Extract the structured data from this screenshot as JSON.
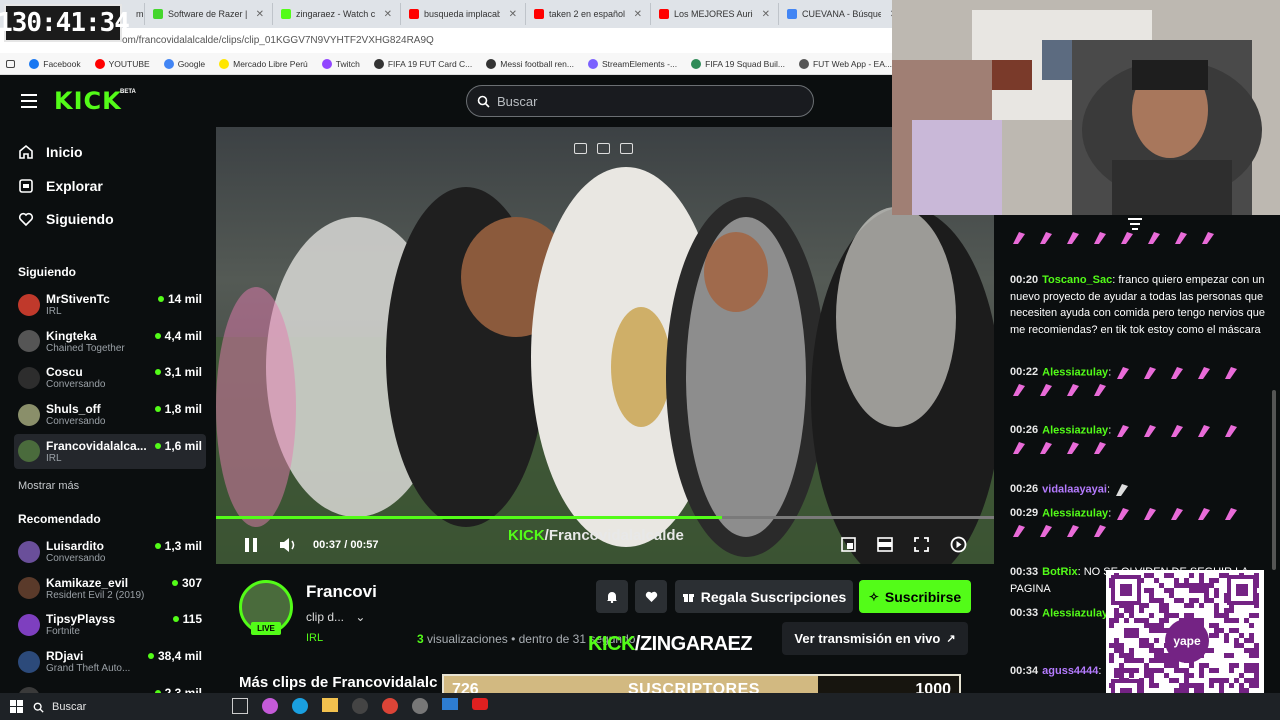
{
  "timer": "130:41:34",
  "browser": {
    "tabs": [
      {
        "label": "Software de Razer | Syn",
        "color": "#44d62c"
      },
      {
        "label": "zingaraez - Watch clips",
        "color": "#53fc18"
      },
      {
        "label": "busqueda implacable 2",
        "color": "#ff0000"
      },
      {
        "label": "taken 2 en español peli",
        "color": "#ff0000"
      },
      {
        "label": "Los MEJORES Auricular",
        "color": "#ff0000"
      },
      {
        "label": "CUEVANA - Búsqueda",
        "color": "#4285f4"
      }
    ],
    "tab_partial": "mi",
    "url": "om/francovidalalcalde/clips/clip_01KGGV7N9VYHTF2VXHG824RA9Q",
    "bookmarks": [
      {
        "label": "Facebook",
        "color": "#1877f2"
      },
      {
        "label": "YOUTUBE",
        "color": "#ff0000"
      },
      {
        "label": "Google",
        "color": "#4285f4"
      },
      {
        "label": "Mercado Libre Perú",
        "color": "#ffe600"
      },
      {
        "label": "Twitch",
        "color": "#9146ff"
      },
      {
        "label": "FIFA 19 FUT Card C...",
        "color": "#333333"
      },
      {
        "label": "Messi football ren...",
        "color": "#333333"
      },
      {
        "label": "StreamElements -...",
        "color": "#7b61ff"
      },
      {
        "label": "FIFA 19 Squad Buil...",
        "color": "#2e8b57"
      },
      {
        "label": "FUT Web App - EA...",
        "color": "#555555"
      }
    ]
  },
  "header": {
    "logo": "KICK",
    "beta": "BETA",
    "search_placeholder": "Buscar"
  },
  "sidebar": {
    "nav": [
      {
        "label": "Inicio",
        "icon": "home-icon"
      },
      {
        "label": "Explorar",
        "icon": "compass-icon"
      },
      {
        "label": "Siguiendo",
        "icon": "heart-icon"
      }
    ],
    "following_title": "Siguiendo",
    "following": [
      {
        "name": "MrStivenTc",
        "category": "IRL",
        "viewers": "14 mil",
        "color": "#c0392b"
      },
      {
        "name": "Kingteka",
        "category": "Chained Together",
        "viewers": "4,4 mil",
        "color": "#555555"
      },
      {
        "name": "Coscu",
        "category": "Conversando",
        "viewers": "3,1 mil",
        "color": "#2d2d2d"
      },
      {
        "name": "Shuls_off",
        "category": "Conversando",
        "viewers": "1,8 mil",
        "color": "#8a8f6a"
      },
      {
        "name": "Francovidalalca...",
        "category": "IRL",
        "viewers": "1,6 mil",
        "color": "#4a6b3c"
      }
    ],
    "show_more": "Mostrar más",
    "recommended_title": "Recomendado",
    "recommended": [
      {
        "name": "Luisardito",
        "category": "Conversando",
        "viewers": "1,3 mil",
        "color": "#6a4f9a"
      },
      {
        "name": "Kamikaze_evil",
        "category": "Resident Evil 2 (2019)",
        "viewers": "307",
        "color": "#5a3a2a"
      },
      {
        "name": "TipsyPlayss",
        "category": "Fortnite",
        "viewers": "115",
        "color": "#7e3fbf"
      },
      {
        "name": "RDjavi",
        "category": "Grand Theft Auto...",
        "viewers": "38,4 mil",
        "color": "#2c4a7a"
      },
      {
        "name": "BukingCI",
        "category": "",
        "viewers": "2,3 mil",
        "color": "#3a3a3a"
      }
    ]
  },
  "player": {
    "time_current": "00:37",
    "time_separator": "/",
    "time_total": "00:57",
    "progress": 0.65,
    "watermark_kick": "KICK",
    "watermark_name": "/Francovidalalcalde"
  },
  "clip": {
    "streamer": "Francovi",
    "live_badge": "LIVE",
    "title": "clip d...",
    "category": "IRL",
    "views_count": "3",
    "views_label": "visualizaciones",
    "time_ago": "• dentro de 31 segundo",
    "gift_button": "Regala Suscripciones",
    "subscribe_button": "Suscribirse",
    "watch_live": "Ver transmisión en vivo",
    "more_clips": "Más clips de Francovidalalc"
  },
  "overlay": {
    "kick_label": "KICK",
    "name": "/ZINGARAEZ",
    "sub_current": "726",
    "sub_label": "SUSCRIPTORES",
    "sub_goal": "1000",
    "sub_progress": 0.726
  },
  "chat": {
    "messages": [
      {
        "time": "",
        "user": "",
        "user_color": "#e0e0e0",
        "text": "",
        "emotes": 8
      },
      {
        "time": "00:20",
        "user": "Toscano_Sac",
        "user_color": "#53fc18",
        "text": "franco quiero empezar con un nuevo proyecto de ayudar a todas las personas que necesiten ayuda con comida pero tengo nervios que me recomiendas? en tik tok estoy como el máscara",
        "emotes": 0
      },
      {
        "time": "00:22",
        "user": "Alessiazulay",
        "user_color": "#53fc18",
        "text": "",
        "emotes": 9
      },
      {
        "time": "00:26",
        "user": "Alessiazulay",
        "user_color": "#53fc18",
        "text": "",
        "emotes": 9
      },
      {
        "time": "00:26",
        "user": "vidalaayayai",
        "user_color": "#b57bff",
        "text": "",
        "emotes": 1
      },
      {
        "time": "00:29",
        "user": "Alessiazulay",
        "user_color": "#53fc18",
        "text": "",
        "emotes": 9
      },
      {
        "time": "00:33",
        "user": "BotRix",
        "user_color": "#53fc18",
        "text": "NO SE OLVIDEN DE SEGUIR LA PAGINA",
        "emotes": 0
      },
      {
        "time": "00:33",
        "user": "Alessiazulay",
        "user_color": "#53fc18",
        "text": "",
        "emotes": 4
      },
      {
        "time": "00:34",
        "user": "aguss4444",
        "user_color": "#b57bff",
        "text": "",
        "emotes": 0
      }
    ]
  },
  "qr": {
    "brand": "yape"
  },
  "taskbar": {
    "search_placeholder": "Buscar"
  }
}
